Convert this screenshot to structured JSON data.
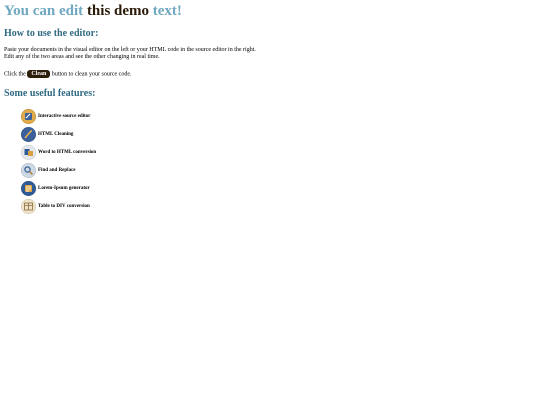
{
  "title": {
    "part1": "You can edit ",
    "part2": "this demo",
    "part3": " text!"
  },
  "section1": {
    "heading": "How to use the editor:",
    "line1": "Paste your documents in the visual editor on the left or your HTML code in the source editor in the right.",
    "line2": "Edit any of the two areas and see the other changing in real time.",
    "click_prefix": "Click the",
    "clean_label": "Clean",
    "click_suffix": "button to clean your source code."
  },
  "section2": {
    "heading": "Some useful features:",
    "features": [
      {
        "label": "Interactive source editor",
        "icon": "interactive-editor-icon",
        "color": "#d9a040"
      },
      {
        "label": "HTML Cleaning",
        "icon": "html-cleaning-icon",
        "color": "#3a5f9a"
      },
      {
        "label": "Word to HTML conversion",
        "icon": "word-conversion-icon",
        "color": "#e2e6ea"
      },
      {
        "label": "Find and Replace",
        "icon": "find-replace-icon",
        "color": "#c8d4e0"
      },
      {
        "label": "Lorem-Ipsum generator",
        "icon": "lorem-ipsum-icon",
        "color": "#2e5b98"
      },
      {
        "label": "Table to DIV conversion",
        "icon": "table-div-icon",
        "color": "#eadfc6"
      }
    ]
  },
  "colors": {
    "title_light": "#6fa8c0",
    "title_dark": "#2b1a08",
    "heading": "#2f6a82",
    "clean_button_bg": "#2b1e0b"
  }
}
